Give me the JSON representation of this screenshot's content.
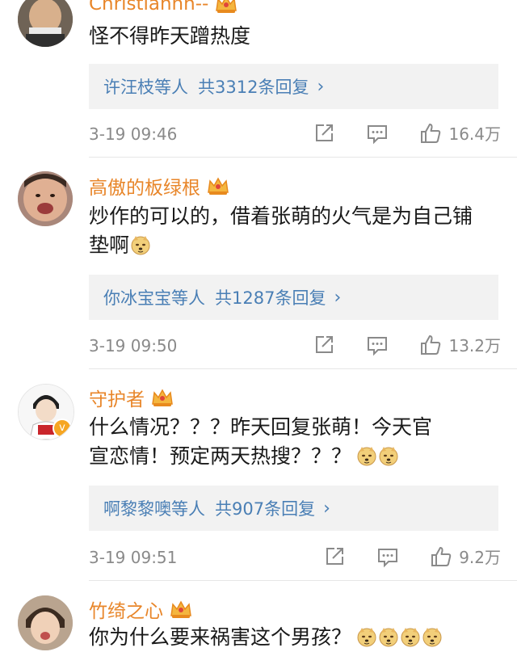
{
  "comments": [
    {
      "username": "Christiannn--",
      "text": "怪不得昨天蹭热度",
      "reply_names": "许汪枝",
      "reply_mid": "等人",
      "reply_count": "共3312条回复",
      "time": "3-19 09:46",
      "likes": "16.4万"
    },
    {
      "username": "高傲的板绿根",
      "text": "炒作的可以的，借着张萌的火气是为自己铺垫啊",
      "reply_names": "你冰宝宝",
      "reply_mid": "等人",
      "reply_count": "共1287条回复",
      "time": "3-19 09:50",
      "likes": "13.2万"
    },
    {
      "username": "守护者",
      "text_line1": "什么情况？？？昨天回复张萌！今天官",
      "text_line2": "宣恋情！预定两天热搜？？？",
      "reply_names": "啊黎黎噢",
      "reply_mid": "等人",
      "reply_count": "共907条回复",
      "time": "3-19 09:51",
      "likes": "9.2万"
    },
    {
      "username": "竹绮之心",
      "text": "你为什么要来祸害这个男孩？"
    }
  ],
  "icons": {
    "crown": "vip-crown-icon",
    "doge": "doge-emoji-icon",
    "share": "share-icon",
    "comment": "comment-icon",
    "like": "like-icon",
    "chevron": "chevron-right-icon"
  }
}
